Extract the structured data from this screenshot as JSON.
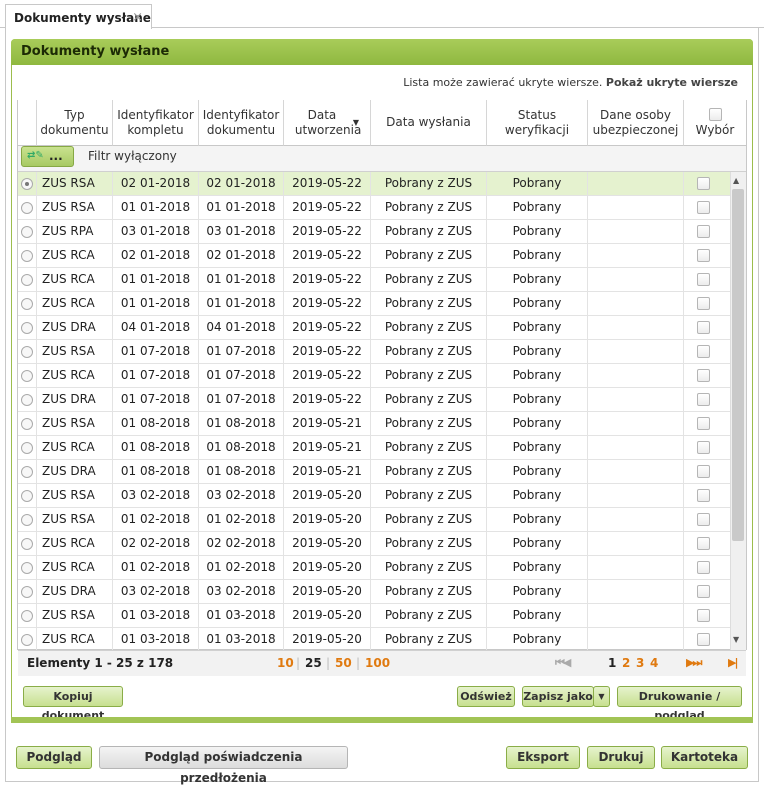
{
  "tab": {
    "title": "Dokumenty wysłane",
    "close": "×"
  },
  "panel": {
    "title": "Dokumenty wysłane"
  },
  "hidden_rows": {
    "text": "Lista może zawierać ukryte wiersze.",
    "link": "Pokaż ukryte wiersze"
  },
  "columns": [
    "Typ dokumentu",
    "Identyfikator kompletu",
    "Identyfikator dokumentu",
    "Data utworzenia",
    "Data wysłania",
    "Status weryfikacji",
    "Dane osoby ubezpieczonej",
    "Wybór"
  ],
  "sort_arrow": "▼",
  "filter": {
    "button_label": "...",
    "status": "Filtr wyłączony"
  },
  "rows": [
    [
      "ZUS RSA",
      "02 01-2018",
      "02 01-2018",
      "2019-05-22",
      "Pobrany z ZUS",
      "Pobrany"
    ],
    [
      "ZUS RSA",
      "01 01-2018",
      "01 01-2018",
      "2019-05-22",
      "Pobrany z ZUS",
      "Pobrany"
    ],
    [
      "ZUS RPA",
      "03 01-2018",
      "03 01-2018",
      "2019-05-22",
      "Pobrany z ZUS",
      "Pobrany"
    ],
    [
      "ZUS RCA",
      "02 01-2018",
      "02 01-2018",
      "2019-05-22",
      "Pobrany z ZUS",
      "Pobrany"
    ],
    [
      "ZUS RCA",
      "01 01-2018",
      "01 01-2018",
      "2019-05-22",
      "Pobrany z ZUS",
      "Pobrany"
    ],
    [
      "ZUS RCA",
      "01 01-2018",
      "01 01-2018",
      "2019-05-22",
      "Pobrany z ZUS",
      "Pobrany"
    ],
    [
      "ZUS DRA",
      "04 01-2018",
      "04 01-2018",
      "2019-05-22",
      "Pobrany z ZUS",
      "Pobrany"
    ],
    [
      "ZUS RSA",
      "01 07-2018",
      "01 07-2018",
      "2019-05-22",
      "Pobrany z ZUS",
      "Pobrany"
    ],
    [
      "ZUS RCA",
      "01 07-2018",
      "01 07-2018",
      "2019-05-22",
      "Pobrany z ZUS",
      "Pobrany"
    ],
    [
      "ZUS DRA",
      "01 07-2018",
      "01 07-2018",
      "2019-05-22",
      "Pobrany z ZUS",
      "Pobrany"
    ],
    [
      "ZUS RSA",
      "01 08-2018",
      "01 08-2018",
      "2019-05-21",
      "Pobrany z ZUS",
      "Pobrany"
    ],
    [
      "ZUS RCA",
      "01 08-2018",
      "01 08-2018",
      "2019-05-21",
      "Pobrany z ZUS",
      "Pobrany"
    ],
    [
      "ZUS DRA",
      "01 08-2018",
      "01 08-2018",
      "2019-05-21",
      "Pobrany z ZUS",
      "Pobrany"
    ],
    [
      "ZUS RSA",
      "03 02-2018",
      "03 02-2018",
      "2019-05-20",
      "Pobrany z ZUS",
      "Pobrany"
    ],
    [
      "ZUS RSA",
      "01 02-2018",
      "01 02-2018",
      "2019-05-20",
      "Pobrany z ZUS",
      "Pobrany"
    ],
    [
      "ZUS RCA",
      "02 02-2018",
      "02 02-2018",
      "2019-05-20",
      "Pobrany z ZUS",
      "Pobrany"
    ],
    [
      "ZUS RCA",
      "01 02-2018",
      "01 02-2018",
      "2019-05-20",
      "Pobrany z ZUS",
      "Pobrany"
    ],
    [
      "ZUS DRA",
      "03 02-2018",
      "03 02-2018",
      "2019-05-20",
      "Pobrany z ZUS",
      "Pobrany"
    ],
    [
      "ZUS RSA",
      "01 03-2018",
      "01 03-2018",
      "2019-05-20",
      "Pobrany z ZUS",
      "Pobrany"
    ],
    [
      "ZUS RCA",
      "01 03-2018",
      "01 03-2018",
      "2019-05-20",
      "Pobrany z ZUS",
      "Pobrany"
    ]
  ],
  "footer": {
    "elements": "Elementy 1 - 25 z 178",
    "page_sizes": [
      "10",
      "25",
      "50",
      "100"
    ],
    "current_page_size": "25",
    "pages": [
      "1",
      "2",
      "3",
      "4"
    ],
    "current_page": "1",
    "first_prev": "⏮◀",
    "next_last": "▶⏭",
    "end_icon": "▶|"
  },
  "actions": {
    "copy": "Kopiuj dokument",
    "refresh": "Odśwież",
    "save_as": "Zapisz jako",
    "save_as_arrow": "▼",
    "print_preview": "Drukowanie / podgląd"
  },
  "bottom": {
    "preview": "Podgląd",
    "proof_preview": "Podgląd poświadczenia przedłożenia",
    "export": "Eksport",
    "print": "Drukuj",
    "card": "Kartoteka"
  }
}
